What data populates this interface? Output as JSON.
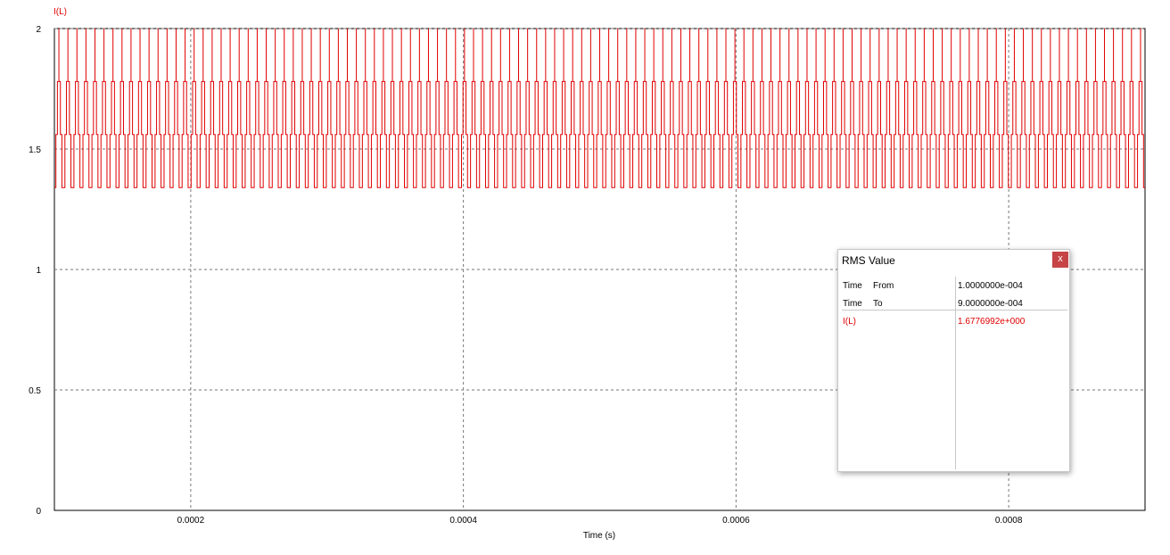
{
  "chart_data": {
    "type": "line",
    "title": "",
    "xlabel": "Time (s)",
    "ylabel": "I(L)",
    "xlim": [
      0.0001,
      0.0009
    ],
    "ylim": [
      0,
      2
    ],
    "x_ticks": [
      0.0002,
      0.0004,
      0.0006,
      0.0008
    ],
    "x_tick_labels": [
      "0.0002",
      "0.0004",
      "0.0006",
      "0.0008"
    ],
    "y_ticks": [
      0,
      0.5,
      1,
      1.5,
      2
    ],
    "y_tick_labels": [
      "0",
      "0.5",
      "1",
      "1.5",
      "2"
    ],
    "grid": true,
    "grid_style": "dashed",
    "series": [
      {
        "name": "I(L)",
        "color": "#e00000",
        "waveform": "stepped-triangle",
        "max": 2.0,
        "min": 1.34,
        "periods_in_window": 121
      }
    ]
  },
  "rms_panel": {
    "title": "RMS Value",
    "close_label": "x",
    "rows": [
      {
        "label": "Time",
        "sub": "From",
        "value": "1.0000000e-004"
      },
      {
        "label": "Time",
        "sub": "To",
        "value": "9.0000000e-004"
      }
    ],
    "result": {
      "label": "I(L)",
      "value": "1.6776992e+000",
      "color": "#e00000"
    }
  }
}
